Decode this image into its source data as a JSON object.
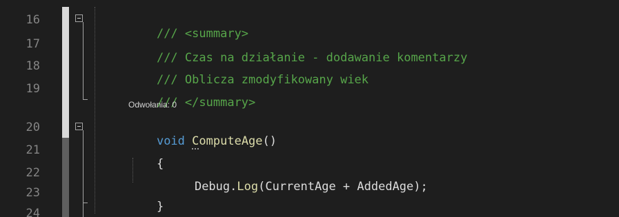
{
  "editor": {
    "line_numbers": [
      "16",
      "17",
      "18",
      "19",
      "20",
      "21",
      "22",
      "23",
      "24"
    ],
    "lines": {
      "l16": {
        "slashes": "///",
        "tag": "<summary>"
      },
      "l17": {
        "slashes": "///",
        "text": "Czas na działanie - dodawanie komentarzy"
      },
      "l18": {
        "slashes": "///",
        "text": "Oblicza zmodyfikowany wiek"
      },
      "l19": {
        "slashes": "///",
        "tag": "</summary>"
      },
      "l20": {
        "keyword": "void",
        "method_first": "C",
        "method_rest": "omputeAge",
        "parens": "()"
      },
      "l21": {
        "brace": "{"
      },
      "l22": {
        "object": "Debug",
        "dot": ".",
        "call": "Log",
        "args": "(CurrentAge + AddedAge);"
      },
      "l23": {
        "brace": "}"
      }
    },
    "codelens": "Odwołania: 0"
  },
  "colors": {
    "background": "#1e1e1e",
    "line_number": "#858585",
    "comment": "#57a64a",
    "keyword": "#569cd6",
    "method": "#dcdcaa",
    "plain": "#dcdcdc"
  }
}
